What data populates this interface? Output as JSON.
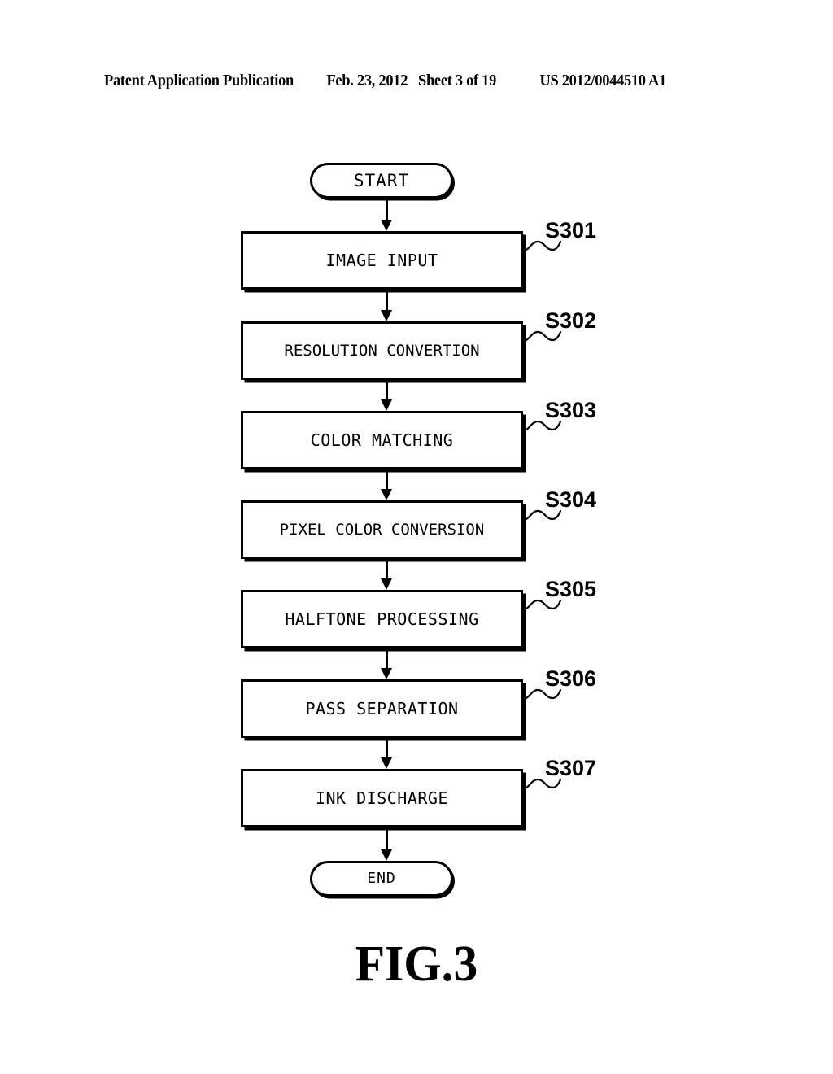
{
  "header": {
    "publication": "Patent Application Publication",
    "date": "Feb. 23, 2012",
    "sheet": "Sheet 3 of 19",
    "document_number": "US 2012/0044510 A1"
  },
  "figure": {
    "caption": "FIG.3",
    "type": "flowchart"
  },
  "flowchart": {
    "start": {
      "label": "START"
    },
    "end": {
      "label": "END"
    },
    "steps": [
      {
        "label": "IMAGE INPUT",
        "ref": "S301"
      },
      {
        "label": "RESOLUTION CONVERTION",
        "ref": "S302"
      },
      {
        "label": "COLOR MATCHING",
        "ref": "S303"
      },
      {
        "label": "PIXEL COLOR CONVERSION",
        "ref": "S304"
      },
      {
        "label": "HALFTONE PROCESSING",
        "ref": "S305"
      },
      {
        "label": "PASS SEPARATION",
        "ref": "S306"
      },
      {
        "label": "INK DISCHARGE",
        "ref": "S307"
      }
    ]
  },
  "colors": {
    "ink": "#000000",
    "paper": "#ffffff"
  }
}
